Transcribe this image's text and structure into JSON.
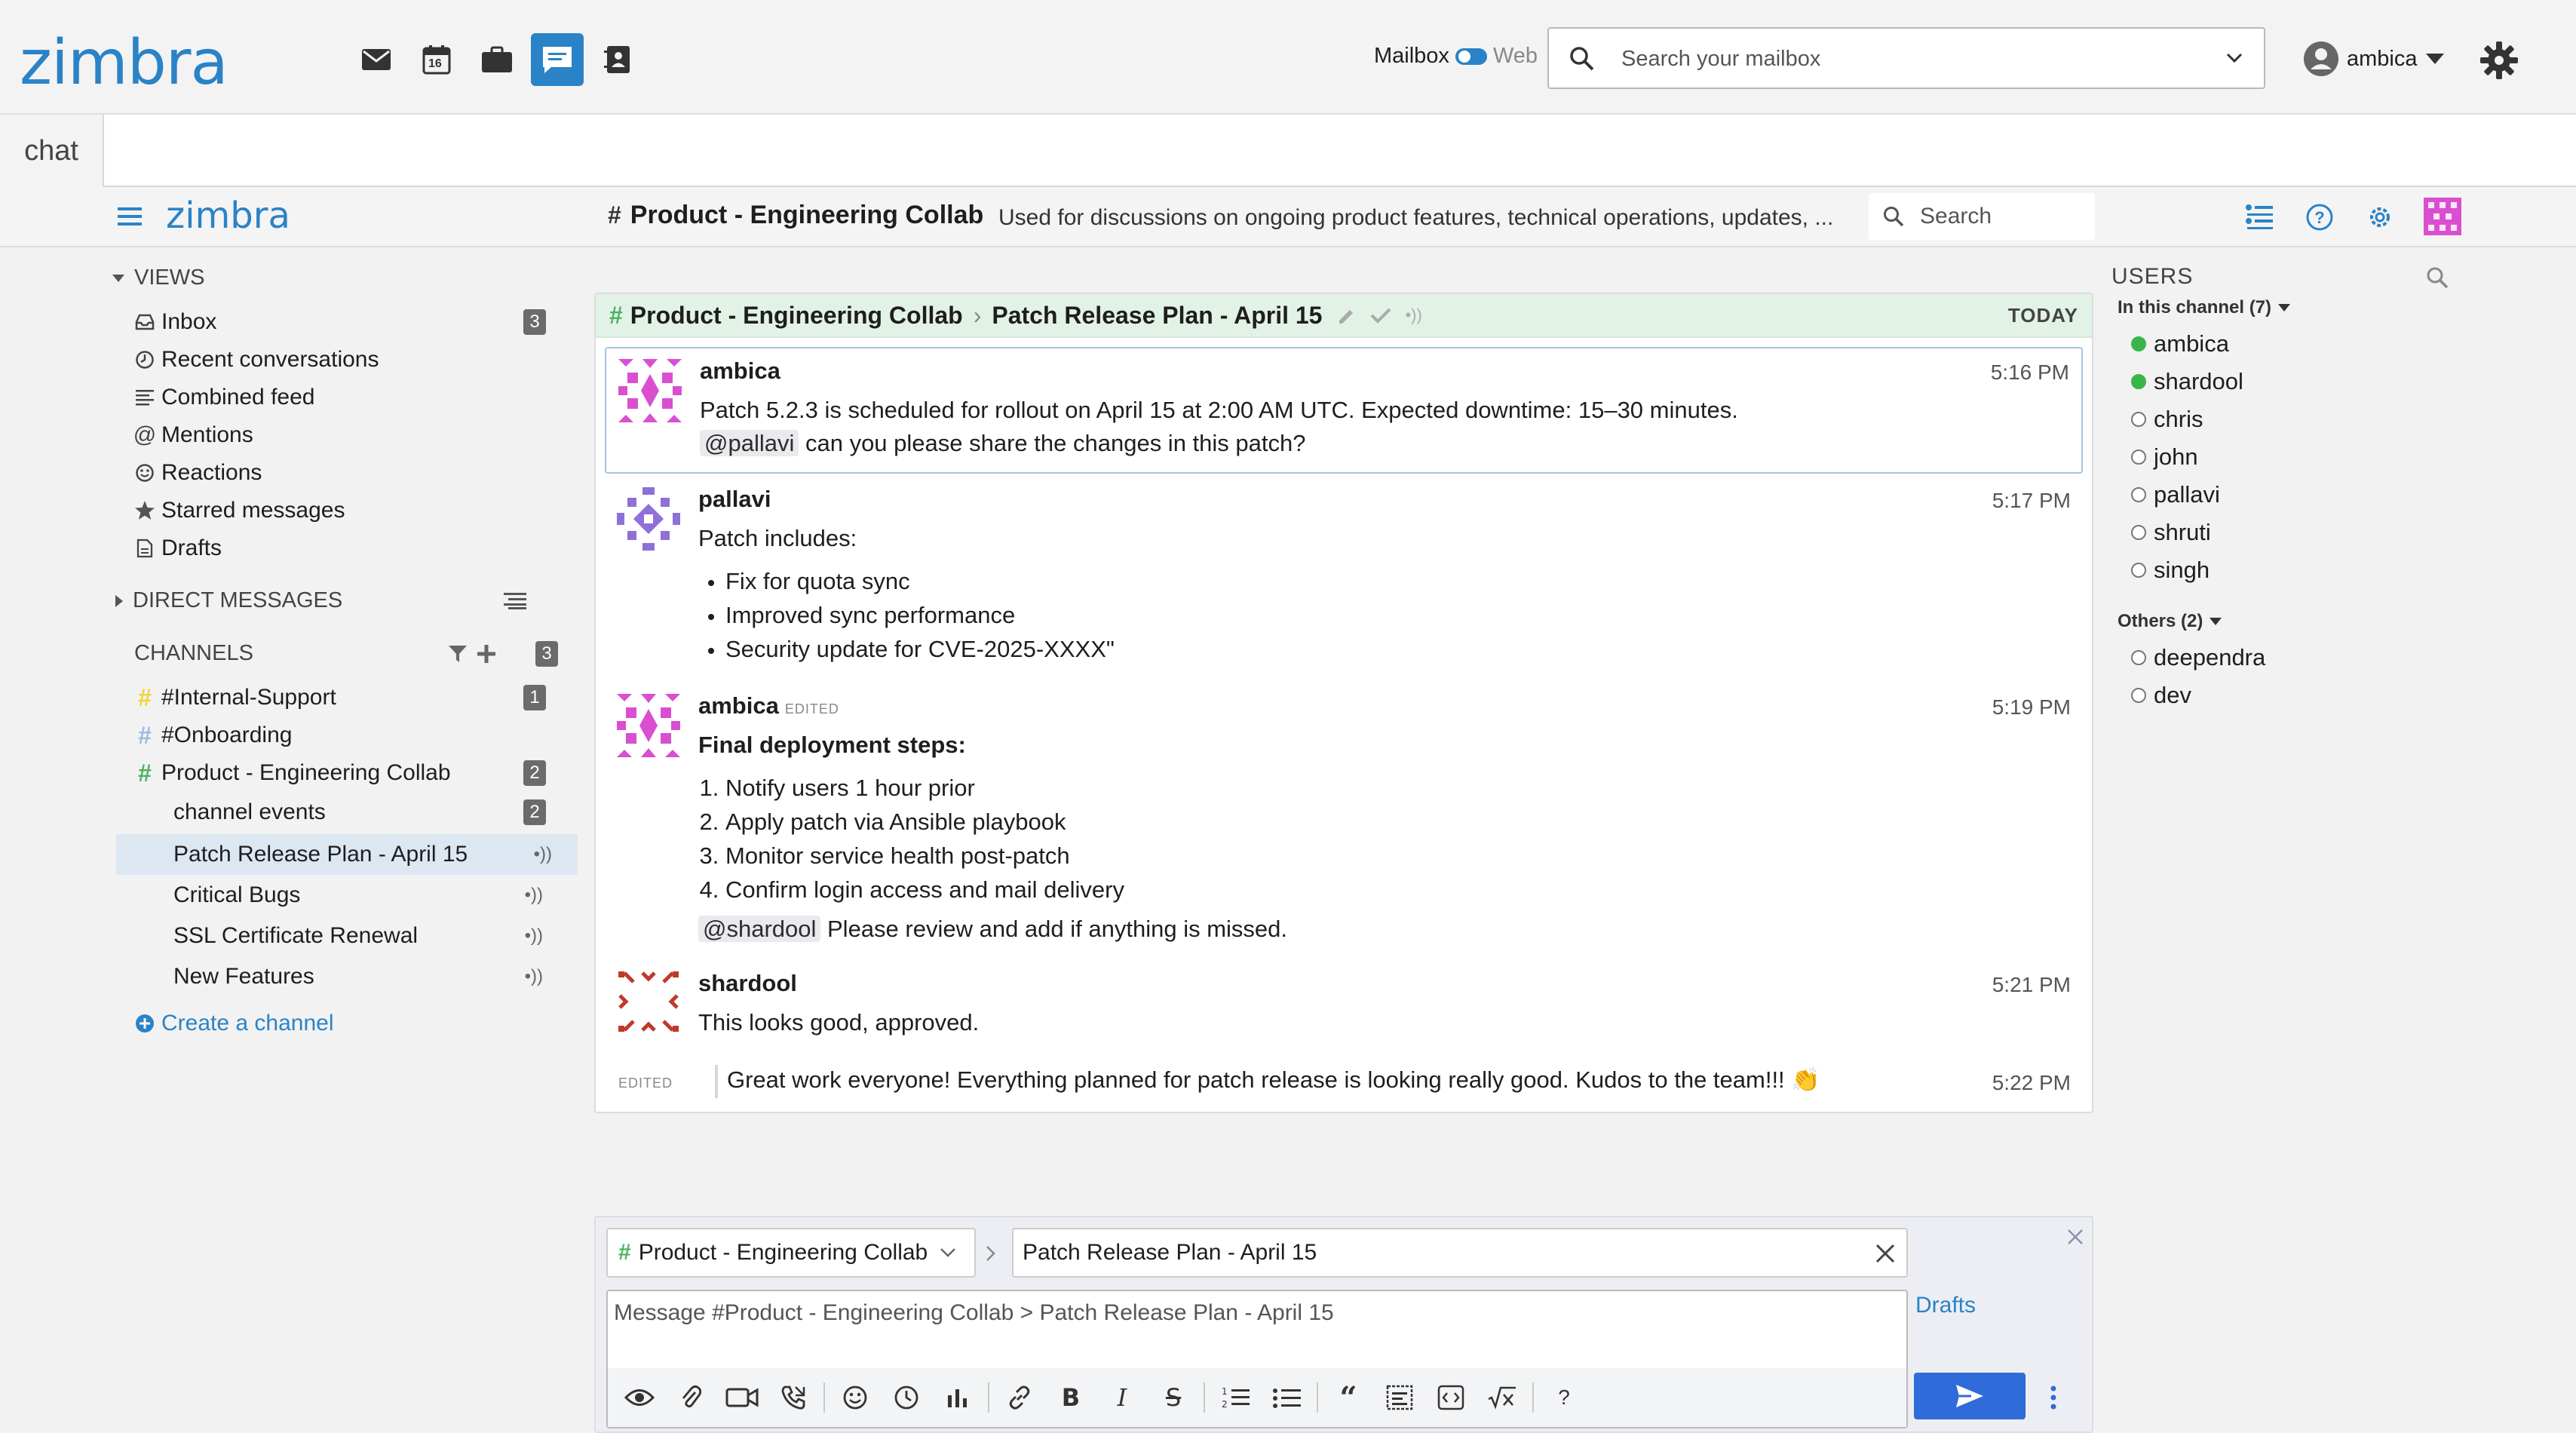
{
  "zimbra": {
    "logo": "zimbra",
    "apps": [
      "mail-icon",
      "calendar-icon",
      "briefcase-icon",
      "chat-icon",
      "contacts-icon"
    ],
    "calendar_day": "16",
    "mailbox_label": "Mailbox",
    "web_label": "Web",
    "search_placeholder": "Search your mailbox",
    "user": "ambica"
  },
  "tab": {
    "label": "chat"
  },
  "header": {
    "logo": "zimbra",
    "channel_name": "Product - Engineering Collab",
    "purpose": "Used for discussions on ongoing product features, technical operations, updates, ...",
    "search_placeholder": "Search"
  },
  "sidebar": {
    "views_label": "VIEWS",
    "views": [
      {
        "label": "Inbox",
        "icon": "inbox-icon",
        "badge": "3"
      },
      {
        "label": "Recent conversations",
        "icon": "clock-icon"
      },
      {
        "label": "Combined feed",
        "icon": "feed-icon"
      },
      {
        "label": "Mentions",
        "icon": "at-icon"
      },
      {
        "label": "Reactions",
        "icon": "smiley-icon"
      },
      {
        "label": "Starred messages",
        "icon": "star-icon"
      },
      {
        "label": "Drafts",
        "icon": "draft-icon"
      }
    ],
    "dm_label": "DIRECT MESSAGES",
    "channels_label": "CHANNELS",
    "channels_badge": "3",
    "channels": [
      {
        "label": "#Internal-Support",
        "badge": "1",
        "color": "#f3d33a"
      },
      {
        "label": "#Onboarding",
        "color": "#9fb8e6"
      },
      {
        "label": "Product - Engineering Collab",
        "badge": "2",
        "color": "#4bb35f"
      }
    ],
    "threads": [
      {
        "label": "channel events",
        "badge": "2"
      },
      {
        "label": "Patch Release Plan - April 15",
        "follow": "•))"
      },
      {
        "label": "Critical Bugs",
        "follow": "•))"
      },
      {
        "label": "SSL Certificate Renewal",
        "follow": "•))"
      },
      {
        "label": "New Features",
        "follow": "•))"
      }
    ],
    "create_channel": "Create a channel"
  },
  "thread": {
    "channel": "Product - Engineering Collab",
    "topic": "Patch Release Plan - April 15",
    "day": "TODAY"
  },
  "posts": {
    "p1": {
      "author": "ambica",
      "time": "5:16 PM",
      "line1": "Patch 5.2.3 is scheduled for rollout on April 15 at 2:00 AM UTC. Expected downtime: 15–30 minutes.",
      "mention": "@pallavi",
      "line2": " can you please share the changes in this patch?"
    },
    "p2": {
      "author": "pallavi",
      "time": "5:17 PM",
      "intro": "Patch includes:",
      "bullets": [
        "Fix for quota sync",
        "Improved sync performance",
        "Security update for CVE-2025-XXXX\""
      ]
    },
    "p3": {
      "author": "ambica",
      "edited": "EDITED",
      "time": "5:19 PM",
      "heading": "Final deployment steps:",
      "steps": [
        "Notify users 1 hour prior",
        "Apply patch via Ansible playbook",
        "Monitor service health post-patch",
        "Confirm login access and mail delivery"
      ],
      "mention": "@shardool",
      "tail": " Please review and add if anything is missed."
    },
    "p4": {
      "author": "shardool",
      "time": "5:21 PM",
      "text": "This looks good, approved."
    },
    "p5": {
      "edited": "EDITED",
      "time": "5:22 PM",
      "text": "Great work everyone! Everything planned for patch release is looking really good. Kudos to the team!!! 👏"
    }
  },
  "users": {
    "title": "USERS",
    "in_channel_label": "In this channel (7)",
    "in_channel": [
      {
        "name": "ambica",
        "online": true
      },
      {
        "name": "shardool",
        "online": true
      },
      {
        "name": "chris",
        "online": false
      },
      {
        "name": "john",
        "online": false
      },
      {
        "name": "pallavi",
        "online": false
      },
      {
        "name": "shruti",
        "online": false
      },
      {
        "name": "singh",
        "online": false
      }
    ],
    "others_label": "Others (2)",
    "others": [
      {
        "name": "deependra",
        "online": false
      },
      {
        "name": "dev",
        "online": false
      }
    ]
  },
  "composer": {
    "channel": "Product - Engineering Collab",
    "thread": "Patch Release Plan - April 15",
    "placeholder": "Message #Product - Engineering Collab > Patch Release Plan - April 15",
    "drafts": "Drafts",
    "help": "?"
  },
  "colors": {
    "accent": "#2a83c6",
    "online": "#3bb54a",
    "send": "#2f6bd9",
    "thread_head": "#e3f2e6"
  }
}
